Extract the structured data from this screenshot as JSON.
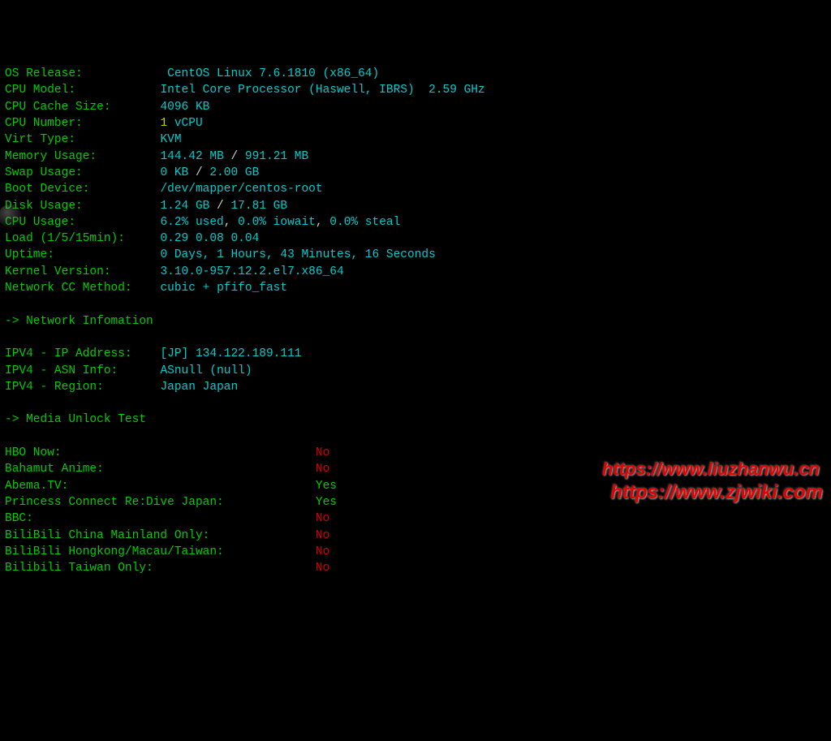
{
  "sys": [
    {
      "label": "OS Release:",
      "pad": 12,
      "parts": [
        {
          "t": "CentOS Linux 7.6.1810 (x86_64)",
          "c": "cyan"
        }
      ]
    },
    {
      "label": "CPU Model:",
      "pad": 12,
      "parts": [
        {
          "t": "Intel Core Processor (Haswell, IBRS)  2.59 GHz",
          "c": "cyan"
        }
      ]
    },
    {
      "label": "CPU Cache Size:",
      "pad": 7,
      "parts": [
        {
          "t": "4096 KB",
          "c": "cyan"
        }
      ]
    },
    {
      "label": "CPU Number:",
      "pad": 11,
      "parts": [
        {
          "t": "1",
          "c": "yellow"
        },
        {
          "t": " vCPU",
          "c": "cyan"
        }
      ]
    },
    {
      "label": "Virt Type:",
      "pad": 12,
      "parts": [
        {
          "t": "KVM",
          "c": "cyan"
        }
      ]
    },
    {
      "label": "Memory Usage:",
      "pad": 9,
      "parts": [
        {
          "t": "144.42 MB",
          "c": "cyan"
        },
        {
          "t": " / ",
          "c": "white"
        },
        {
          "t": "991.21 MB",
          "c": "cyan"
        }
      ]
    },
    {
      "label": "Swap Usage:",
      "pad": 11,
      "parts": [
        {
          "t": "0 KB",
          "c": "cyan"
        },
        {
          "t": " / ",
          "c": "white"
        },
        {
          "t": "2.00 GB",
          "c": "cyan"
        }
      ]
    },
    {
      "label": "Boot Device:",
      "pad": 10,
      "parts": [
        {
          "t": "/dev/mapper/centos-root",
          "c": "cyan"
        }
      ]
    },
    {
      "label": "Disk Usage:",
      "pad": 11,
      "parts": [
        {
          "t": "1.24 GB",
          "c": "cyan"
        },
        {
          "t": " / ",
          "c": "white"
        },
        {
          "t": "17.81 GB",
          "c": "cyan"
        }
      ]
    },
    {
      "label": "CPU Usage:",
      "pad": 12,
      "parts": [
        {
          "t": "6.2% used",
          "c": "cyan"
        },
        {
          "t": ", ",
          "c": "white"
        },
        {
          "t": "0.0% iowait",
          "c": "cyan"
        },
        {
          "t": ", ",
          "c": "white"
        },
        {
          "t": "0.0% steal",
          "c": "cyan"
        }
      ]
    },
    {
      "label": "Load (1/5/15min):",
      "pad": 5,
      "parts": [
        {
          "t": "0.29 0.08 0.04",
          "c": "cyan"
        }
      ]
    },
    {
      "label": "Uptime:",
      "pad": 15,
      "parts": [
        {
          "t": "0 Days, 1 Hours, 43 Minutes, 16 Seconds",
          "c": "cyan"
        }
      ]
    },
    {
      "label": "Kernel Version:",
      "pad": 7,
      "parts": [
        {
          "t": "3.10.0-957.12.2.el7.x86_64",
          "c": "cyan"
        }
      ]
    },
    {
      "label": "Network CC Method:",
      "pad": 4,
      "parts": [
        {
          "t": "cubic + pfifo_fast",
          "c": "cyan"
        }
      ]
    }
  ],
  "net_header": "-> Network Infomation",
  "net": [
    {
      "label": "IPV4 - IP Address:",
      "pad": 4,
      "parts": [
        {
          "t": "[JP] 134.122.189.111",
          "c": "cyan"
        }
      ]
    },
    {
      "label": "IPV4 - ASN Info:",
      "pad": 6,
      "parts": [
        {
          "t": "ASnull (null)",
          "c": "cyan"
        }
      ]
    },
    {
      "label": "IPV4 - Region:",
      "pad": 8,
      "parts": [
        {
          "t": "Japan Japan",
          "c": "cyan"
        }
      ]
    }
  ],
  "media_header": "-> Media Unlock Test",
  "media_pad_total": 44,
  "media": [
    {
      "name": "HBO Now:",
      "val": "No",
      "c": "red"
    },
    {
      "name": "Bahamut Anime:",
      "val": "No",
      "c": "red"
    },
    {
      "name": "Abema.TV:",
      "val": "Yes",
      "c": "green"
    },
    {
      "name": "Princess Connect Re:Dive Japan:",
      "val": "Yes",
      "c": "green"
    },
    {
      "name": "BBC:",
      "val": "No",
      "c": "red"
    },
    {
      "name": "BiliBili China Mainland Only:",
      "val": "No",
      "c": "red"
    },
    {
      "name": "BiliBili Hongkong/Macau/Taiwan:",
      "val": "No",
      "c": "red"
    },
    {
      "name": "Bilibili Taiwan Only:",
      "val": "No",
      "c": "red"
    }
  ],
  "watermark1": "https://www.liuzhanwu.cn",
  "watermark2": "https://www.zjwiki.com"
}
